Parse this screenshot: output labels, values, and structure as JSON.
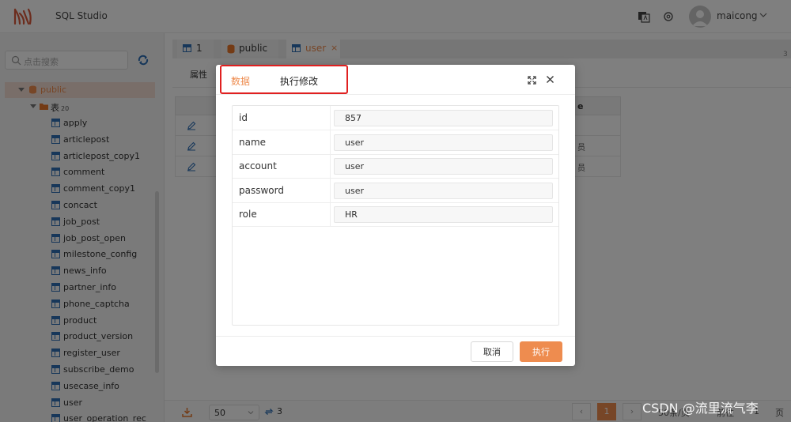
{
  "app": {
    "title": "SQL Studio",
    "user_name": "maicong"
  },
  "sidebar": {
    "search_placeholder": "点击搜索",
    "schema": "public",
    "group_label": "表",
    "group_count": "20",
    "tables": [
      "apply",
      "articlepost",
      "articlepost_copy1",
      "comment",
      "comment_copy1",
      "concact",
      "job_post",
      "job_post_open",
      "milestone_config",
      "news_info",
      "partner_info",
      "phone_captcha",
      "product",
      "product_version",
      "register_user",
      "subscribe_demo",
      "usecase_info",
      "user",
      "user_operation_rec"
    ]
  },
  "tabs": [
    {
      "label": "1"
    },
    {
      "label": "public"
    },
    {
      "label": "user",
      "close": "×"
    }
  ],
  "tab_counter": "3",
  "subtab": "属性",
  "table": {
    "column_header": "e",
    "rows": [
      "",
      "员",
      "员"
    ]
  },
  "pager": {
    "page_size": "50",
    "count": "3",
    "current_page": "1",
    "prev": "‹",
    "next": "›",
    "per_page": "50条/页",
    "goto_label": "前往",
    "goto_value": "1",
    "page_suffix": "页"
  },
  "dialog": {
    "tab_data": "数据",
    "tab_execute": "执行修改",
    "fields": [
      {
        "label": "id",
        "value": "857"
      },
      {
        "label": "name",
        "value": "user"
      },
      {
        "label": "account",
        "value": "user"
      },
      {
        "label": "password",
        "value": "user"
      },
      {
        "label": "role",
        "value": "HR"
      }
    ],
    "cancel_label": "取消",
    "execute_label": "执行"
  },
  "watermark": "CSDN @流里流气李",
  "colors": {
    "accent": "#ee8c4f",
    "highlight": "#e02020",
    "table_icon": "#2f6fb5"
  }
}
